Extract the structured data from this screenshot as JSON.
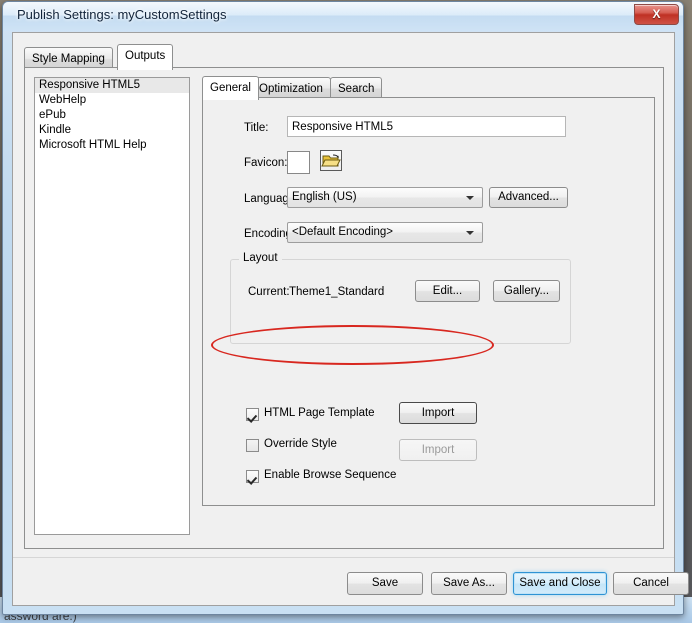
{
  "window": {
    "title": "Publish Settings: myCustomSettings",
    "close_label": "X"
  },
  "outer_tabs": [
    {
      "label": "Style Mapping",
      "active": false
    },
    {
      "label": "Outputs",
      "active": true
    }
  ],
  "output_list": {
    "items": [
      {
        "label": "Responsive HTML5",
        "selected": true
      },
      {
        "label": "WebHelp",
        "selected": false
      },
      {
        "label": "ePub",
        "selected": false
      },
      {
        "label": "Kindle",
        "selected": false
      },
      {
        "label": "Microsoft HTML Help",
        "selected": false
      }
    ]
  },
  "inner_tabs": [
    {
      "label": "General",
      "active": true
    },
    {
      "label": "Optimization",
      "active": false
    },
    {
      "label": "Search",
      "active": false
    }
  ],
  "general": {
    "title_label": "Title:",
    "title_value": "Responsive HTML5",
    "favicon_label": "Favicon:",
    "favicon_value": "",
    "favicon_browse_icon": "open-folder-icon",
    "language_label": "Language:",
    "language_value": "English (US)",
    "advanced_button": "Advanced...",
    "encoding_label": "Encoding:",
    "encoding_value": "<Default Encoding>",
    "layout_group_title": "Layout",
    "layout_current_label": "Current:",
    "layout_current_value": "Theme1_Standard",
    "edit_button": "Edit...",
    "gallery_button": "Gallery...",
    "html_page_template_label": "HTML Page Template",
    "html_page_template_checked": true,
    "html_page_template_import": "Import",
    "override_style_label": "Override Style",
    "override_style_checked": false,
    "override_style_import": "Import",
    "enable_browse_sequence_label": "Enable Browse Sequence",
    "enable_browse_sequence_checked": true
  },
  "footer": {
    "save": "Save",
    "save_as": "Save As...",
    "save_and_close": "Save and Close",
    "cancel": "Cancel"
  },
  "background": {
    "clipped_text": "assword are.)"
  },
  "colors": {
    "accent_default_button": "#2f93d4",
    "annotation_red": "#d8271f",
    "close_button_red": "#bf3124",
    "selection_gray": "#e8e8e8",
    "folder_icon_yellow": "#e8c139"
  }
}
